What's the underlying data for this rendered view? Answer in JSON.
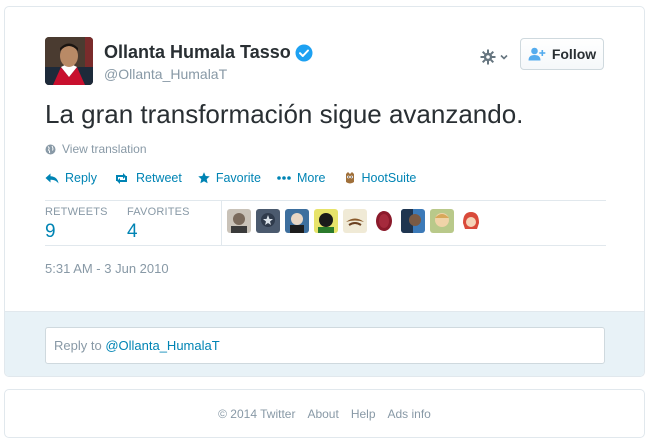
{
  "profile": {
    "name": "Ollanta Humala Tasso",
    "handle": "@Ollanta_HumalaT",
    "verified": true
  },
  "follow_button": {
    "label": "Follow",
    "icon": "add-user-icon"
  },
  "tweet": {
    "text": "La gran transformación sigue avanzando.",
    "translate_label": "View translation",
    "timestamp": "5:31 AM - 3 Jun 2010"
  },
  "actions": [
    {
      "label": "Reply",
      "icon": "reply-icon"
    },
    {
      "label": "Retweet",
      "icon": "retweet-icon"
    },
    {
      "label": "Favorite",
      "icon": "star-icon"
    },
    {
      "label": "More",
      "icon": "more-dots-icon"
    },
    {
      "label": "HootSuite",
      "icon": "hootsuite-owl-icon"
    }
  ],
  "stats": {
    "retweets_label": "RETWEETS",
    "retweets_value": "9",
    "favorites_label": "FAVORITES",
    "favorites_value": "4"
  },
  "reply": {
    "prefix": "Reply to ",
    "mention": "@Ollanta_HumalaT"
  },
  "footer": {
    "copyright": "© 2014 Twitter",
    "links": [
      "About",
      "Help",
      "Ads info"
    ]
  },
  "colors": {
    "link": "#0084b4",
    "muted": "#8899a6",
    "verified": "#1da1f2",
    "reply_bg": "#e8f2f7"
  }
}
